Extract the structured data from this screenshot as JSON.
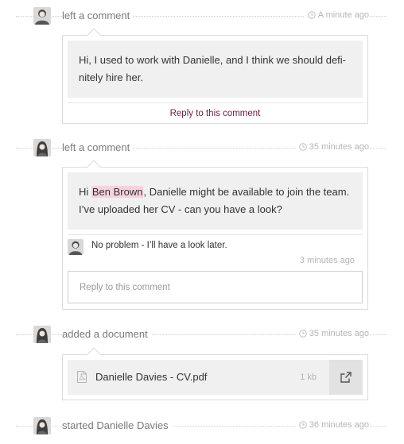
{
  "activities": [
    {
      "label": "left a comment",
      "time": "A minute ago",
      "comment": "Hi, I used to work with Danielle, and I think we should defi-nitely hire her.",
      "reply_link": "Reply to this comment"
    },
    {
      "label": "left a comment",
      "time": "35 minutes ago",
      "comment_before": "Hi ",
      "mention": "Ben Brown",
      "comment_after": ", Danielle might be available to join the team. I’ve uploaded her CV - can you have a look?",
      "reply": {
        "text": "No problem - I’ll have a look later.",
        "time": "3 minutes ago"
      },
      "reply_placeholder": "Reply to this comment"
    },
    {
      "label": "added a document",
      "time": "35 minutes ago",
      "document": {
        "name": "Danielle Davies - CV.pdf",
        "size": "1 kb"
      }
    },
    {
      "label": "started Danielle Davies",
      "time": "36 minutes ago"
    }
  ],
  "colors": {
    "accent": "#6b1f3e",
    "mention_bg": "#f6d3dc",
    "bubble_bg": "#f0f0f0"
  },
  "icons": {
    "time": "clock-icon",
    "file": "pdf-file-icon",
    "open": "external-link-icon"
  }
}
